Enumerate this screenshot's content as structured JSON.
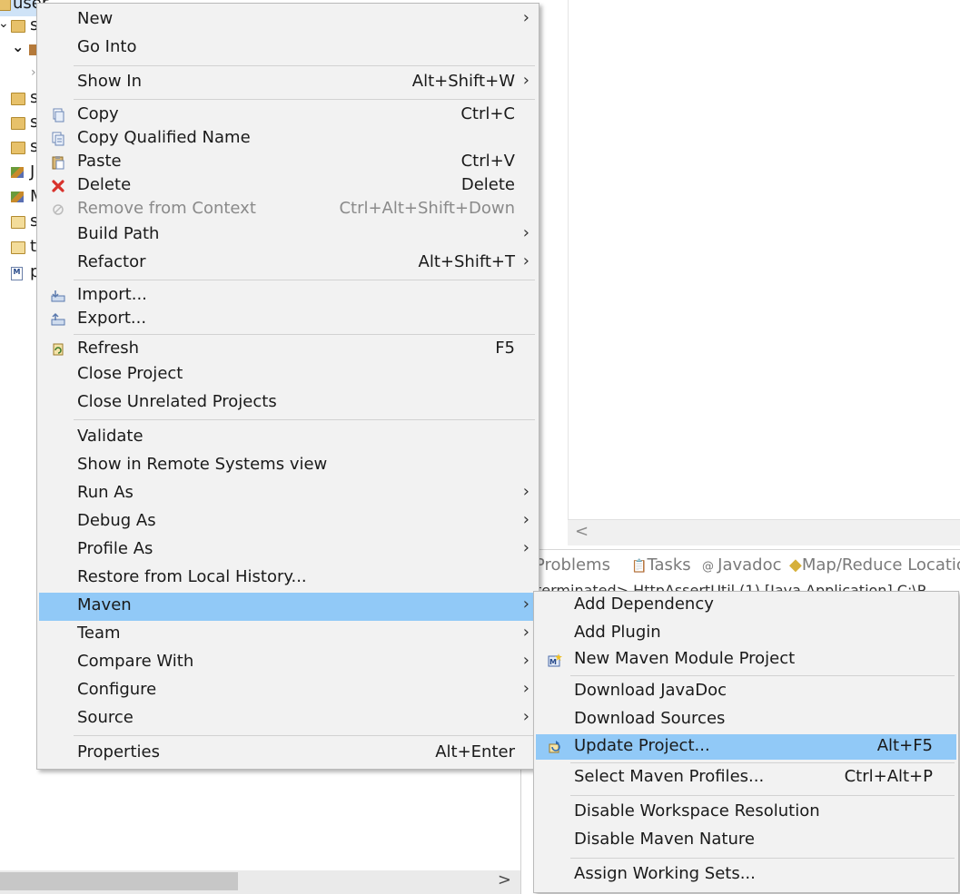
{
  "tree": {
    "rows": [
      {
        "label": "user",
        "indent": 0
      },
      {
        "label": "s",
        "indent": 1
      },
      {
        "label": "",
        "indent": 2
      },
      {
        "label": "",
        "indent": 3
      },
      {
        "label": "s",
        "indent": 1
      },
      {
        "label": "s",
        "indent": 1
      },
      {
        "label": "s",
        "indent": 1
      },
      {
        "label": "J",
        "indent": 1
      },
      {
        "label": "M",
        "indent": 1
      },
      {
        "label": "s",
        "indent": 1
      },
      {
        "label": "t",
        "indent": 1
      },
      {
        "label": "p",
        "indent": 1
      }
    ]
  },
  "views": {
    "problems": "Problems",
    "tasks": "Tasks",
    "javadoc": "Javadoc",
    "mapreduce": "Map/Reduce Locatio",
    "console_line": "terminated> HttpAssertUtil (1) [Java Application] C:\\P"
  },
  "scroll": {
    "left_arrow": "<",
    "right_arrow": ">"
  },
  "menu": {
    "new": {
      "label": "New",
      "shortcut": ""
    },
    "go_into": {
      "label": "Go Into",
      "shortcut": ""
    },
    "show_in": {
      "label": "Show In",
      "shortcut": "Alt+Shift+W"
    },
    "copy": {
      "label": "Copy",
      "shortcut": "Ctrl+C"
    },
    "copy_qualified": {
      "label": "Copy Qualified Name",
      "shortcut": ""
    },
    "paste": {
      "label": "Paste",
      "shortcut": "Ctrl+V"
    },
    "delete": {
      "label": "Delete",
      "shortcut": "Delete"
    },
    "remove_context": {
      "label": "Remove from Context",
      "shortcut": "Ctrl+Alt+Shift+Down"
    },
    "build_path": {
      "label": "Build Path",
      "shortcut": ""
    },
    "refactor": {
      "label": "Refactor",
      "shortcut": "Alt+Shift+T"
    },
    "import": {
      "label": "Import...",
      "shortcut": ""
    },
    "export": {
      "label": "Export...",
      "shortcut": ""
    },
    "refresh": {
      "label": "Refresh",
      "shortcut": "F5"
    },
    "close_project": {
      "label": "Close Project",
      "shortcut": ""
    },
    "close_unrelated": {
      "label": "Close Unrelated Projects",
      "shortcut": ""
    },
    "validate": {
      "label": "Validate",
      "shortcut": ""
    },
    "show_remote": {
      "label": "Show in Remote Systems view",
      "shortcut": ""
    },
    "run_as": {
      "label": "Run As",
      "shortcut": ""
    },
    "debug_as": {
      "label": "Debug As",
      "shortcut": ""
    },
    "profile_as": {
      "label": "Profile As",
      "shortcut": ""
    },
    "restore_history": {
      "label": "Restore from Local History...",
      "shortcut": ""
    },
    "maven": {
      "label": "Maven",
      "shortcut": ""
    },
    "team": {
      "label": "Team",
      "shortcut": ""
    },
    "compare_with": {
      "label": "Compare With",
      "shortcut": ""
    },
    "configure": {
      "label": "Configure",
      "shortcut": ""
    },
    "source": {
      "label": "Source",
      "shortcut": ""
    },
    "properties": {
      "label": "Properties",
      "shortcut": "Alt+Enter"
    }
  },
  "submenu": {
    "add_dependency": {
      "label": "Add Dependency",
      "shortcut": ""
    },
    "add_plugin": {
      "label": "Add Plugin",
      "shortcut": ""
    },
    "new_module": {
      "label": "New Maven Module Project",
      "shortcut": ""
    },
    "download_javadoc": {
      "label": "Download JavaDoc",
      "shortcut": ""
    },
    "download_sources": {
      "label": "Download Sources",
      "shortcut": ""
    },
    "update_project": {
      "label": "Update Project...",
      "shortcut": "Alt+F5"
    },
    "select_profiles": {
      "label": "Select Maven Profiles...",
      "shortcut": "Ctrl+Alt+P"
    },
    "disable_workspace": {
      "label": "Disable Workspace Resolution",
      "shortcut": ""
    },
    "disable_nature": {
      "label": "Disable Maven Nature",
      "shortcut": ""
    },
    "assign_sets": {
      "label": "Assign Working Sets...",
      "shortcut": ""
    }
  },
  "colors": {
    "highlight": "#91c9f7",
    "menu_bg": "#f2f2f2",
    "disabled_text": "#8a8a8a"
  }
}
